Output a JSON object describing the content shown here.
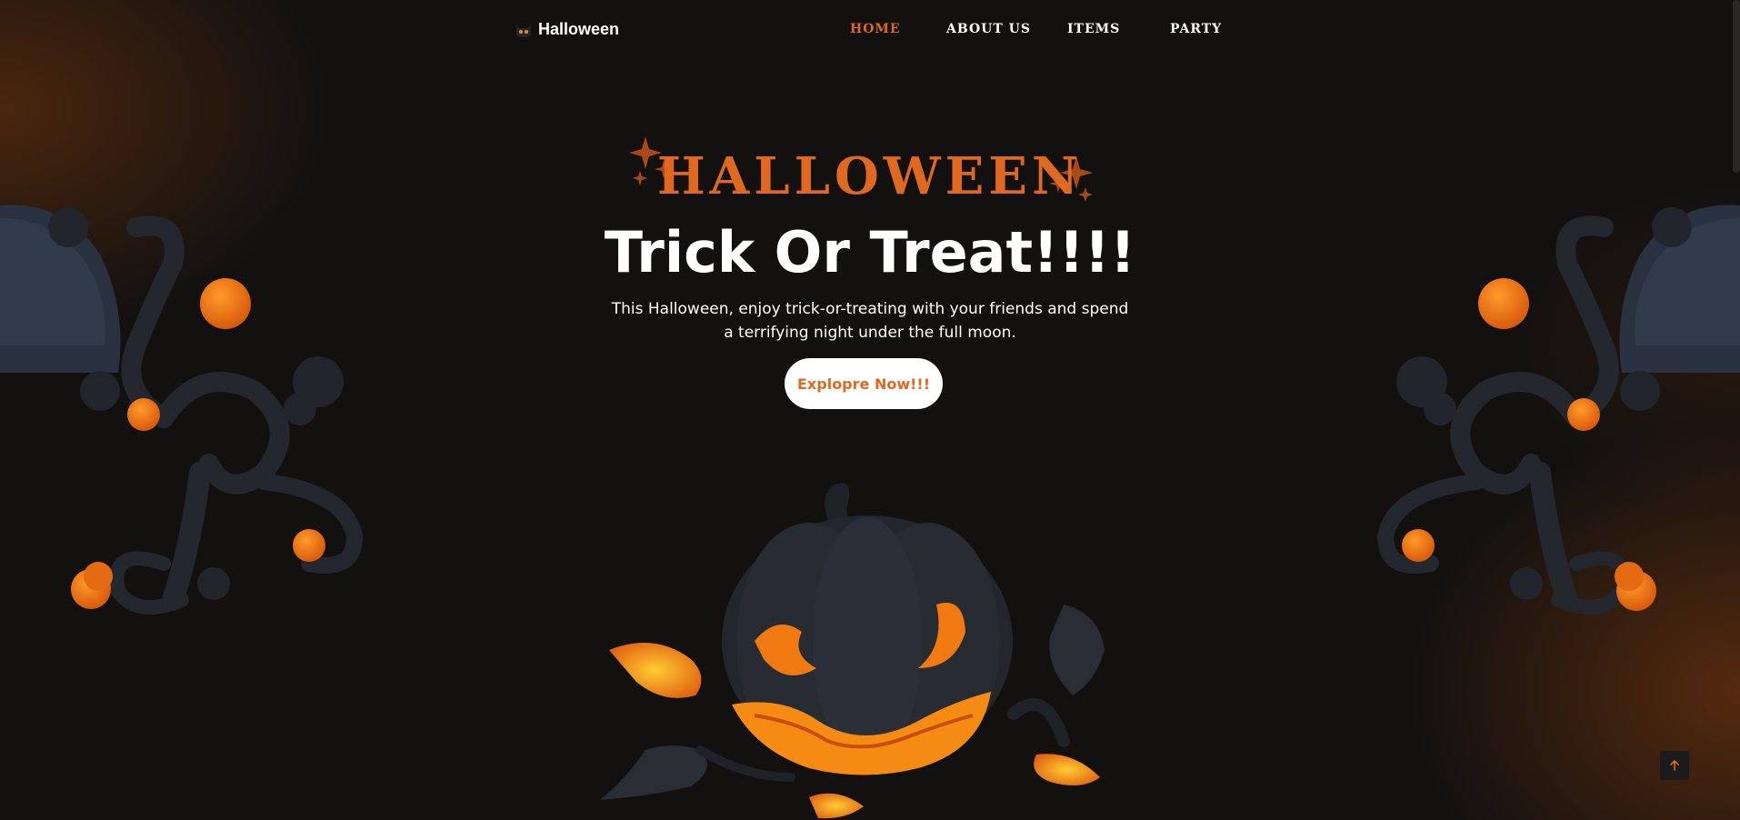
{
  "header": {
    "brand": {
      "name": "Halloween",
      "icon": "halloween-cat-icon"
    },
    "nav": [
      {
        "id": "home",
        "label": "HOME",
        "active": true
      },
      {
        "id": "about",
        "label": "ABOUT US",
        "active": false
      },
      {
        "id": "items",
        "label": "ITEMS",
        "active": false
      },
      {
        "id": "party",
        "label": "PARTY",
        "active": false
      }
    ]
  },
  "hero": {
    "eyebrow": "HALLOWEEN",
    "title": "Trick Or Treat!!!!",
    "description": "This Halloween, enjoy trick-or-treating with your friends and spend a terrifying night under the full moon.",
    "cta_label": "Explopre Now!!!"
  },
  "decorations": {
    "left_branch": "spooky-branch-illustration",
    "right_branch": "spooky-branch-illustration",
    "pumpkin": "jack-o-lantern-illustration",
    "sparkles": "sparkle-stars-icon"
  },
  "scroll_to_top": {
    "icon": "arrow-up-icon"
  },
  "colors": {
    "accent": "#e0691f",
    "background": "#121110",
    "branch": "#2b3038",
    "glow": "#f48a12"
  }
}
